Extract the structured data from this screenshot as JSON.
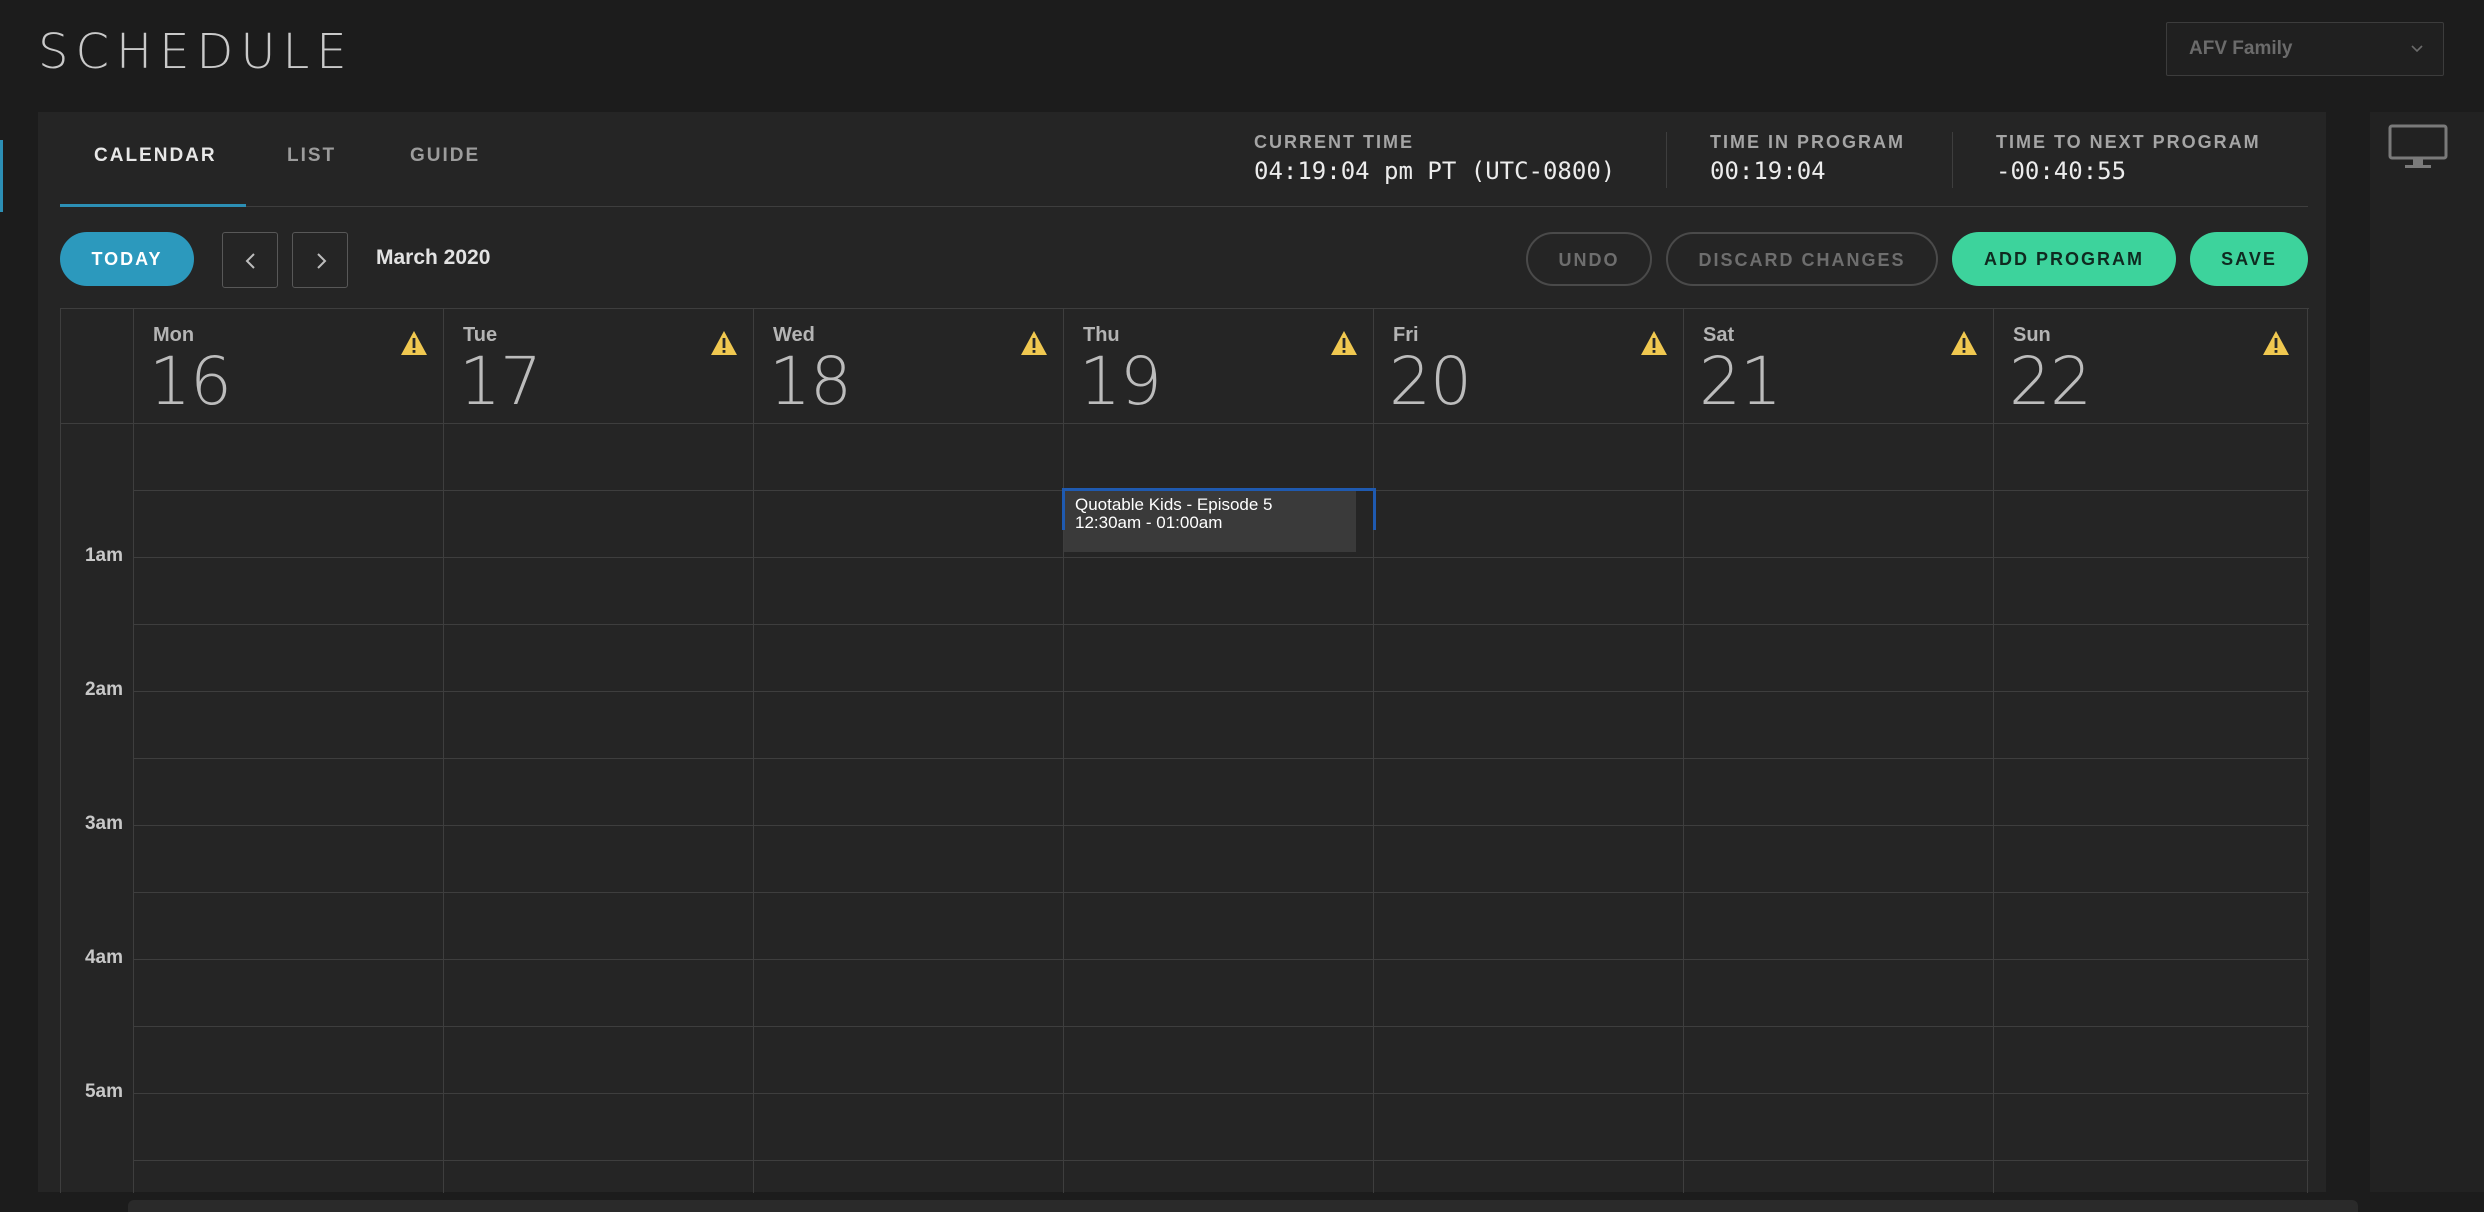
{
  "header": {
    "title": "SCHEDULE"
  },
  "channel_select": {
    "value": "AFV Family",
    "icon": "chevron-down-icon"
  },
  "tabs": [
    {
      "label": "CALENDAR",
      "active": true
    },
    {
      "label": "LIST",
      "active": false
    },
    {
      "label": "GUIDE",
      "active": false
    }
  ],
  "info": {
    "current_time": {
      "label": "CURRENT TIME",
      "value": "04:19:04 pm PT (UTC-0800)"
    },
    "time_in_program": {
      "label": "TIME IN PROGRAM",
      "value": "00:19:04"
    },
    "time_to_next": {
      "label": "TIME TO NEXT PROGRAM",
      "value": "-00:40:55"
    }
  },
  "toolbar": {
    "today_label": "TODAY",
    "month_label": "March 2020",
    "undo_label": "UNDO",
    "discard_label": "DISCARD CHANGES",
    "add_program_label": "ADD PROGRAM",
    "save_label": "SAVE"
  },
  "calendar": {
    "days": [
      {
        "name": "Mon",
        "num": "16"
      },
      {
        "name": "Tue",
        "num": "17"
      },
      {
        "name": "Wed",
        "num": "18"
      },
      {
        "name": "Thu",
        "num": "19"
      },
      {
        "name": "Fri",
        "num": "20"
      },
      {
        "name": "Sat",
        "num": "21"
      },
      {
        "name": "Sun",
        "num": "22"
      }
    ],
    "hours": [
      "1am",
      "2am",
      "3am",
      "4am",
      "5am"
    ],
    "event": {
      "title": "Quotable Kids - Episode 5",
      "time": "12:30am - 01:00am"
    }
  },
  "colors": {
    "accent_blue": "#2c99bd",
    "accent_green": "#3dd39c",
    "warning": "#f0c850",
    "selection_border": "#1f5ab0"
  },
  "icons": {
    "warning": "warning-icon",
    "prev": "chevron-left-icon",
    "next": "chevron-right-icon",
    "monitor": "monitor-icon"
  }
}
